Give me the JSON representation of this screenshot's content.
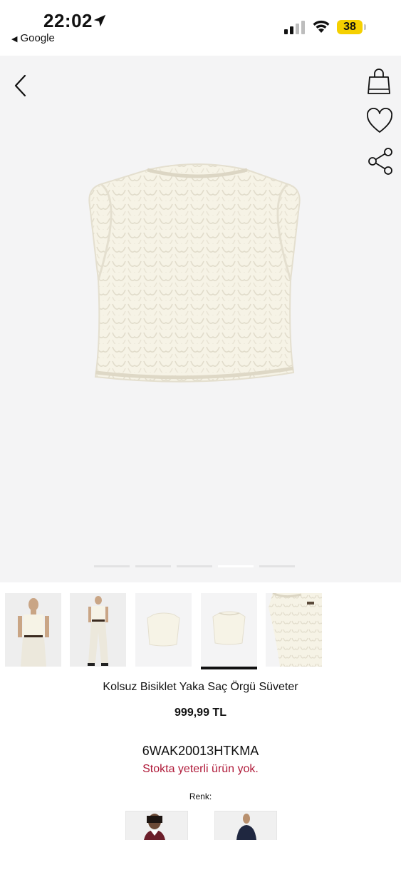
{
  "status_bar": {
    "time": "22:02",
    "back_app": "Google",
    "battery": "38",
    "colors": {
      "battery": "#f5d000"
    }
  },
  "header": {
    "back_icon": "chevron-left-icon",
    "actions": [
      "shopping-bag-icon",
      "heart-icon",
      "share-icon"
    ]
  },
  "gallery": {
    "dots": 5,
    "active_dot_index": 3,
    "thumbnails_count": 5,
    "selected_thumbnail_index": 3
  },
  "product": {
    "name": "Kolsuz Bisiklet Yaka Saç Örgü Süveter",
    "price": "999,99 TL",
    "sku": "6WAK20013HTKMA",
    "stock_message": "Stokta yeterli ürün yok.",
    "color_label": "Renk:"
  },
  "colors": {
    "hero_bg": "#f4f4f5",
    "stock_text": "#b01b3a",
    "vest": "#f6f3e6"
  }
}
